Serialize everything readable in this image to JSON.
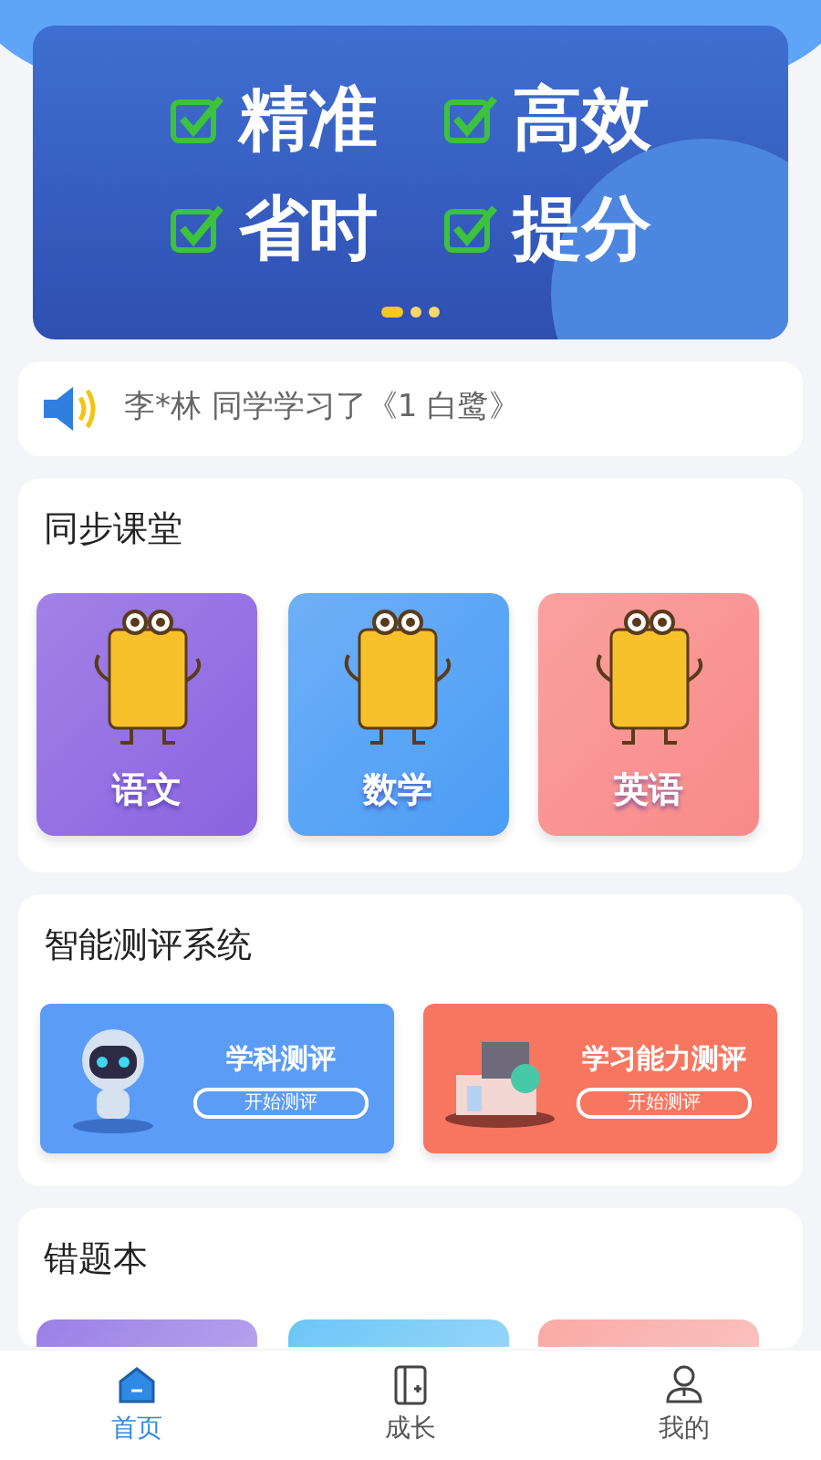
{
  "banner": {
    "slogans": [
      "精准",
      "高效",
      "省时",
      "提分"
    ],
    "dots": [
      {
        "selected": true
      },
      {
        "selected": false
      },
      {
        "selected": false
      }
    ]
  },
  "notice": {
    "text": "李*林 同学学习了《1 白鹭》"
  },
  "sync_class": {
    "title": "同步课堂",
    "subjects": [
      {
        "label": "语文",
        "color": "#8a63e0"
      },
      {
        "label": "数学",
        "color": "#4a9cf5"
      },
      {
        "label": "英语",
        "color": "#f88a88"
      }
    ]
  },
  "assessment": {
    "title": "智能测评系统",
    "cards": [
      {
        "kind": "robot",
        "title": "学科测评",
        "button": "开始测评",
        "color": "#5b9cf6"
      },
      {
        "kind": "books",
        "title": "学习能力测评",
        "button": "开始测评",
        "color": "#f7765f"
      }
    ]
  },
  "wrong_book": {
    "title": "错题本",
    "cards": [
      {
        "color": "#9a7fe6"
      },
      {
        "color": "#6cc6f7"
      },
      {
        "color": "#f9aaa6"
      }
    ]
  },
  "tab_bar": [
    {
      "kind": "home",
      "label": "首页",
      "selected": true
    },
    {
      "kind": "growth",
      "label": "成长",
      "selected": false
    },
    {
      "kind": "profile",
      "label": "我的",
      "selected": false
    }
  ]
}
